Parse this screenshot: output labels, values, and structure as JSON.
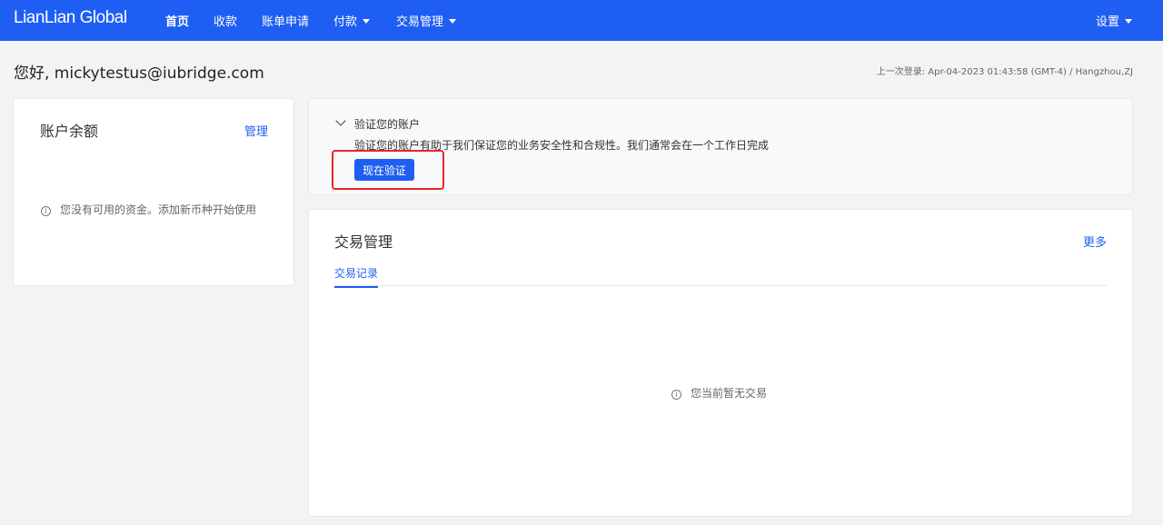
{
  "header": {
    "logo": "LianLian Global",
    "nav": [
      {
        "label": "首页",
        "active": true
      },
      {
        "label": "收款"
      },
      {
        "label": "账单申请"
      },
      {
        "label": "付款",
        "dropdown": true
      },
      {
        "label": "交易管理",
        "dropdown": true
      }
    ],
    "settings_label": "设置"
  },
  "greeting": "您好, mickytestus@iubridge.com",
  "last_login": "上一次登录: Apr-04-2023 01:43:58 (GMT-4) / Hangzhou,ZJ",
  "balance_card": {
    "title": "账户余额",
    "manage_link": "管理",
    "empty_text": "您没有可用的资金。添加新币种开始使用"
  },
  "verify_card": {
    "title": "验证您的账户",
    "description": "验证您的账户有助于我们保证您的业务安全性和合规性。我们通常会在一个工作日完成",
    "button_label": "现在验证"
  },
  "trade_card": {
    "title": "交易管理",
    "more_link": "更多",
    "tabs": [
      {
        "label": "交易记录",
        "active": true
      }
    ],
    "empty_text": "您当前暂无交易"
  },
  "colors": {
    "brand_blue": "#1f5ef2",
    "highlight_red": "#e8262a",
    "page_bg": "#f2f3f5"
  },
  "icons": {
    "info": "info-circle-icon",
    "chevron": "chevron-down-icon",
    "caret": "caret-down-icon"
  }
}
